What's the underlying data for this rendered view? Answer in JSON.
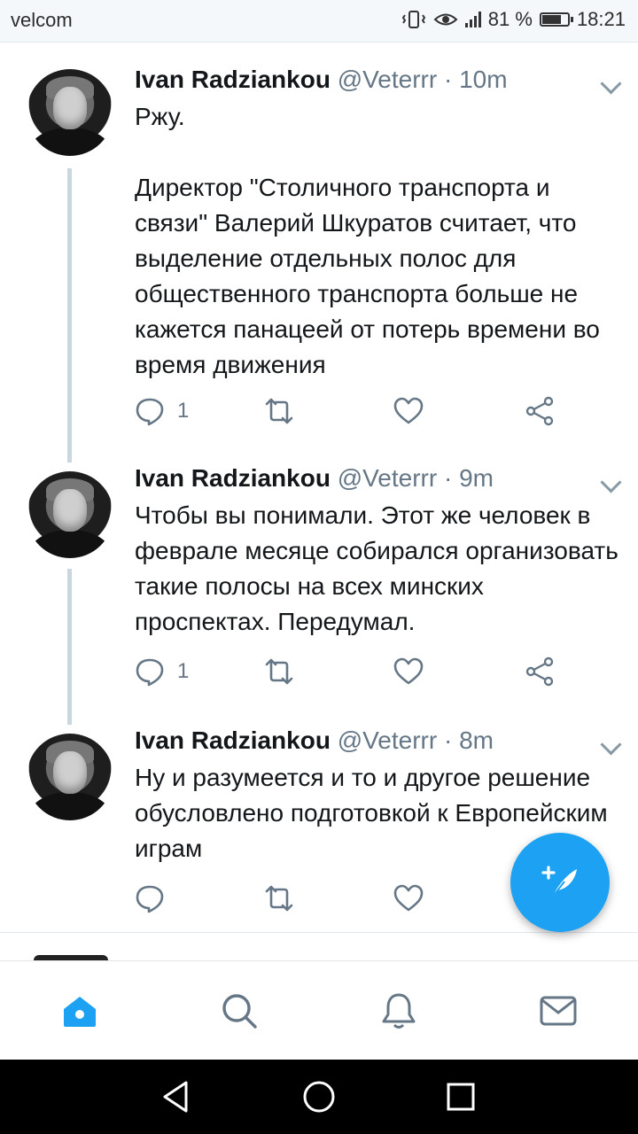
{
  "status_bar": {
    "carrier": "velcom",
    "battery_percent": "81 %",
    "battery_level": 0.81,
    "time": "18:21"
  },
  "tweets": [
    {
      "name": "Ivan Radziankou",
      "handle": "@Veterrr",
      "separator": "·",
      "time": "10m",
      "text": "Ржу.\n\nДиректор \"Столичного транспорта и связи\" Валерий Шкуратов считает, что выделение отдельных полос для общественного транспорта больше не кажется панацеей от потерь времени во время движения",
      "reply_count": "1"
    },
    {
      "name": "Ivan Radziankou",
      "handle": "@Veterrr",
      "separator": "·",
      "time": "9m",
      "text": "Чтобы вы понимали. Этот же человек в феврале месяце собирался организовать такие полосы на всех минских проспектах. Передумал.",
      "reply_count": "1"
    },
    {
      "name": "Ivan Radziankou",
      "handle": "@Veterrr",
      "separator": "·",
      "time": "8m",
      "text": "Ну и разумеется и то и другое решение обусловлено подготовкой к Европейским играм",
      "reply_count": ""
    }
  ],
  "colors": {
    "accent": "#1da1f2",
    "icon_gray": "#657786",
    "text": "#14171a",
    "divider": "#e1e8ed"
  },
  "icons": {
    "reply": "comment-icon",
    "retweet": "retweet-icon",
    "like": "heart-icon",
    "share": "share-icon",
    "compose": "compose-tweet-icon",
    "tabs": [
      "home-icon",
      "search-icon",
      "notifications-icon",
      "messages-icon"
    ],
    "nav": [
      "back-icon",
      "home-circle-icon",
      "recents-icon"
    ]
  }
}
